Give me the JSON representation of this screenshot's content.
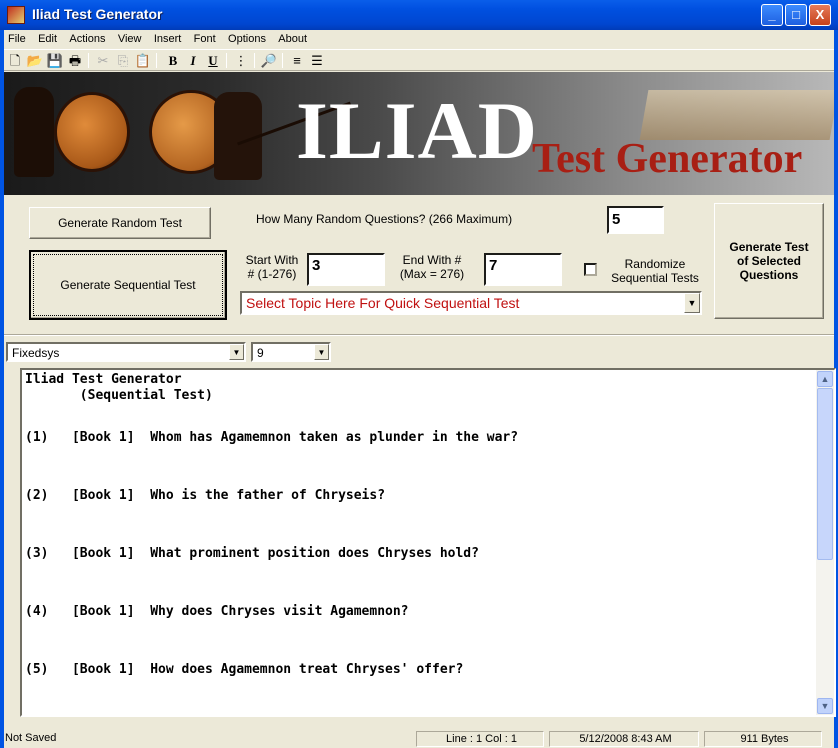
{
  "window": {
    "title": "Iliad Test Generator",
    "minimize": "_",
    "maximize": "□",
    "close": "X"
  },
  "menu": [
    {
      "label": "File"
    },
    {
      "label": "Edit"
    },
    {
      "label": "Actions"
    },
    {
      "label": "View"
    },
    {
      "label": "Insert"
    },
    {
      "label": "Font"
    },
    {
      "label": "Options"
    },
    {
      "label": "About"
    }
  ],
  "toolbar": {
    "icons": [
      "new-icon",
      "open-icon",
      "save-icon",
      "print-icon",
      "cut-icon",
      "copy-icon",
      "paste-icon",
      "bold-icon",
      "italic-icon",
      "underline-icon",
      "bullets-icon",
      "find-icon",
      "align-left-icon",
      "align-center-icon"
    ],
    "bold": "B",
    "italic": "I",
    "underline": "U"
  },
  "banner": {
    "main": "ILIAD",
    "sub": "Test Generator"
  },
  "controls": {
    "random_button": "Generate Random Test",
    "sequential_button": "Generate Sequential Test",
    "how_many_label": "How Many Random Questions? (266 Maximum)",
    "how_many_value": "5",
    "start_label_1": "Start With",
    "start_label_2": "# (1-276)",
    "start_value": "3",
    "end_label_1": "End With #",
    "end_label_2": "(Max = 276)",
    "end_value": "7",
    "randomize_label_1": "Randomize",
    "randomize_label_2": "Sequential Tests",
    "randomize_checked": false,
    "topic_select": "Select Topic Here For Quick Sequential Test",
    "selected_button_1": "Generate Test",
    "selected_button_2": "of Selected",
    "selected_button_3": "Questions"
  },
  "font_row": {
    "font": "Fixedsys",
    "size": "9"
  },
  "editor": {
    "line1": "Iliad Test Generator",
    "line2": "       (Sequential Test)",
    "questions": [
      "(1)   [Book 1]  Whom has Agamemnon taken as plunder in the war?",
      "(2)   [Book 1]  Who is the father of Chryseis?",
      "(3)   [Book 1]  What prominent position does Chryses hold?",
      "(4)   [Book 1]  Why does Chryses visit Agamemnon?",
      "(5)   [Book 1]  How does Agamemnon treat Chryses' offer?"
    ]
  },
  "status": {
    "saved": "Not Saved",
    "position": "Line : 1   Col : 1",
    "datetime": "5/12/2008  8:43 AM",
    "size": "911 Bytes"
  }
}
